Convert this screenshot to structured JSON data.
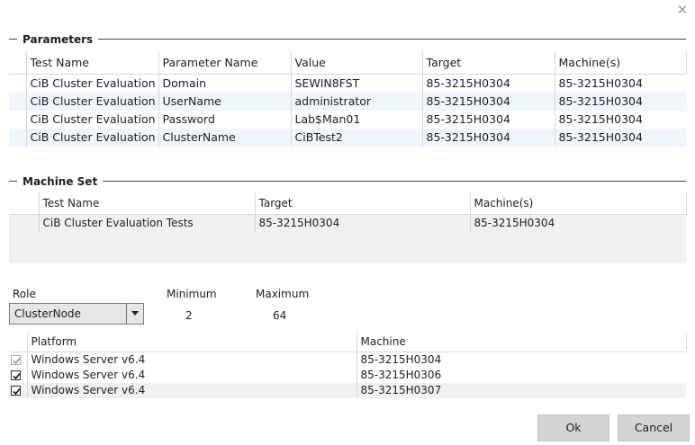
{
  "close_glyph": "✕",
  "parameters": {
    "title": "Parameters",
    "columns": [
      "Test Name",
      "Parameter Name",
      "Value",
      "Target",
      "Machine(s)"
    ],
    "rows": [
      [
        "CiB Cluster Evaluation Te",
        "Domain",
        "SEWIN8FST",
        "85-3215H0304",
        "85-3215H0304"
      ],
      [
        "CiB Cluster Evaluation Te",
        "UserName",
        "administrator",
        "85-3215H0304",
        "85-3215H0304"
      ],
      [
        "CiB Cluster Evaluation Te",
        "Password",
        "Lab$Man01",
        "85-3215H0304",
        "85-3215H0304"
      ],
      [
        "CiB Cluster Evaluation Te",
        "ClusterName",
        "CiBTest2",
        "85-3215H0304",
        "85-3215H0304"
      ]
    ]
  },
  "machine_set": {
    "title": "Machine Set",
    "columns": [
      "Test Name",
      "Target",
      "Machine(s)"
    ],
    "rows": [
      [
        "CiB Cluster Evaluation Tests",
        "85-3215H0304",
        "85-3215H0304"
      ]
    ]
  },
  "role": {
    "label": "Role",
    "selected": "ClusterNode",
    "minimum_label": "Minimum",
    "minimum_value": "2",
    "maximum_label": "Maximum",
    "maximum_value": "64"
  },
  "platforms": {
    "columns": [
      "Platform",
      "Machine"
    ],
    "rows": [
      {
        "checked": true,
        "dim": true,
        "platform": "Windows Server v6.4",
        "machine": "85-3215H0304"
      },
      {
        "checked": true,
        "dim": false,
        "platform": "Windows Server v6.4",
        "machine": "85-3215H0306"
      },
      {
        "checked": true,
        "dim": false,
        "platform": "Windows Server v6.4",
        "machine": "85-3215H0307"
      }
    ]
  },
  "buttons": {
    "ok": "Ok",
    "cancel": "Cancel"
  }
}
